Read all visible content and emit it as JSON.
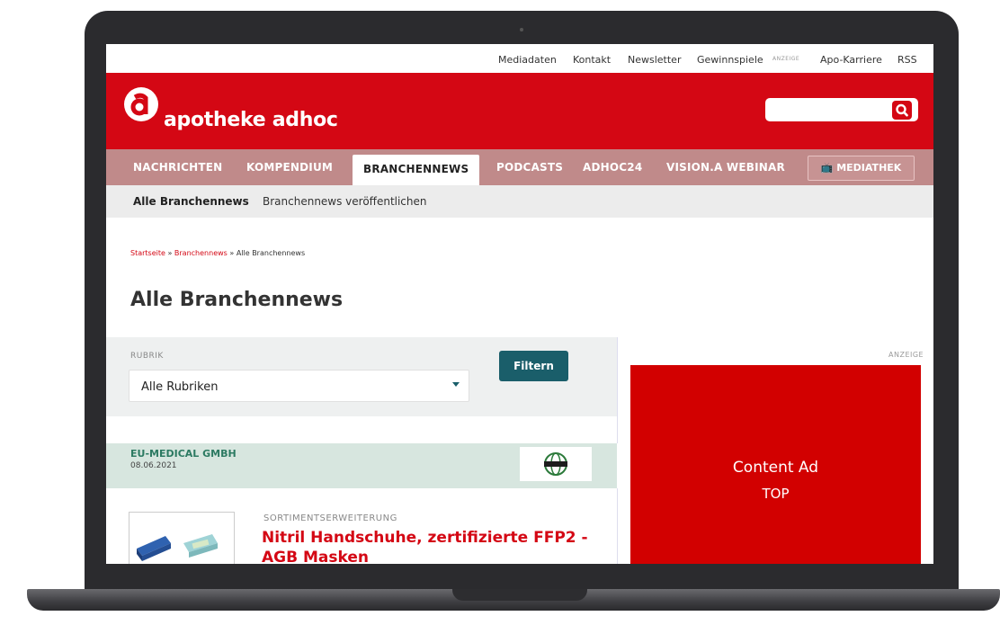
{
  "utility_nav": {
    "mediadaten": "Mediadaten",
    "kontakt": "Kontakt",
    "newsletter": "Newsletter",
    "gewinnspiele": "Gewinnspiele",
    "anzeige_tag": "ANZEIGE",
    "apo_karriere": "Apo-Karriere",
    "rss": "RSS"
  },
  "header": {
    "logo_text": "apotheke adhoc",
    "search_placeholder": "",
    "brand_color": "#d40714"
  },
  "main_nav": {
    "items": [
      "NACHRICHTEN",
      "KOMPENDIUM",
      "BRANCHENNEWS",
      "PODCASTS",
      "ADHOC24",
      "VISION.A WEBINAR"
    ],
    "active": "BRANCHENNEWS",
    "mediathek": "MEDIATHEK"
  },
  "sub_nav": {
    "items": [
      "Alle Branchennews",
      "Branchennews veröffentlichen"
    ]
  },
  "breadcrumb": {
    "home": "Startseite",
    "sep1": " » ",
    "section": "Branchennews",
    "sep2": " » ",
    "current": "Alle Branchennews"
  },
  "page_title": "Alle Branchennews",
  "filter": {
    "label": "RUBRIK",
    "selected": "Alle Rubriken",
    "button": "Filtern",
    "button_color": "#1a5e6a"
  },
  "company": {
    "name": "EU-MEDICAL GMBH",
    "date": "08.06.2021"
  },
  "article": {
    "kicker": "SORTIMENTSERWEITERUNG",
    "title_line1": "Nitril Handschuhe, zertifizierte FFP2 -",
    "title_line2": "AGB Masken"
  },
  "ad": {
    "label": "ANZEIGE",
    "title": "Content Ad",
    "subtitle": "TOP",
    "color": "#d20000"
  }
}
